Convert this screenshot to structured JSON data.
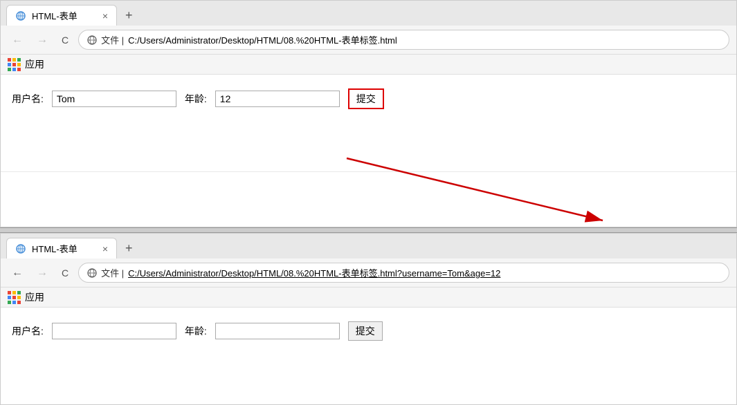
{
  "browser1": {
    "tab": {
      "title": "HTML-表单",
      "close": "×",
      "new_tab": "+"
    },
    "nav": {
      "back_label": "←",
      "forward_label": "→",
      "refresh_label": "C",
      "address_prefix": "文件  |  ",
      "address_url": "C:/Users/Administrator/Desktop/HTML/08.%20HTML-表单标签.html"
    },
    "apps_bar": {
      "label": "应用"
    },
    "form": {
      "username_label": "用户名:",
      "username_value": "Tom",
      "age_label": "年龄:",
      "age_value": "12",
      "submit_label": "提交"
    }
  },
  "browser2": {
    "tab": {
      "title": "HTML-表单",
      "close": "×",
      "new_tab": "+"
    },
    "nav": {
      "back_label": "←",
      "forward_label": "→",
      "refresh_label": "C",
      "address_prefix": "文件  |  ",
      "address_url": "C:/Users/Administrator/Desktop/HTML/08.%20HTML-表单标签.html?username=Tom&age=12"
    },
    "apps_bar": {
      "label": "应用"
    },
    "form": {
      "username_label": "用户名:",
      "username_value": "",
      "age_label": "年龄:",
      "age_value": "",
      "submit_label": "提交"
    }
  },
  "icons": {
    "globe": "🌐",
    "apps_colors": [
      "#ea4335",
      "#fbbc04",
      "#34a853",
      "#4285f4",
      "#ea4335",
      "#fbbc04",
      "#34a853",
      "#4285f4",
      "#ea4335"
    ]
  }
}
